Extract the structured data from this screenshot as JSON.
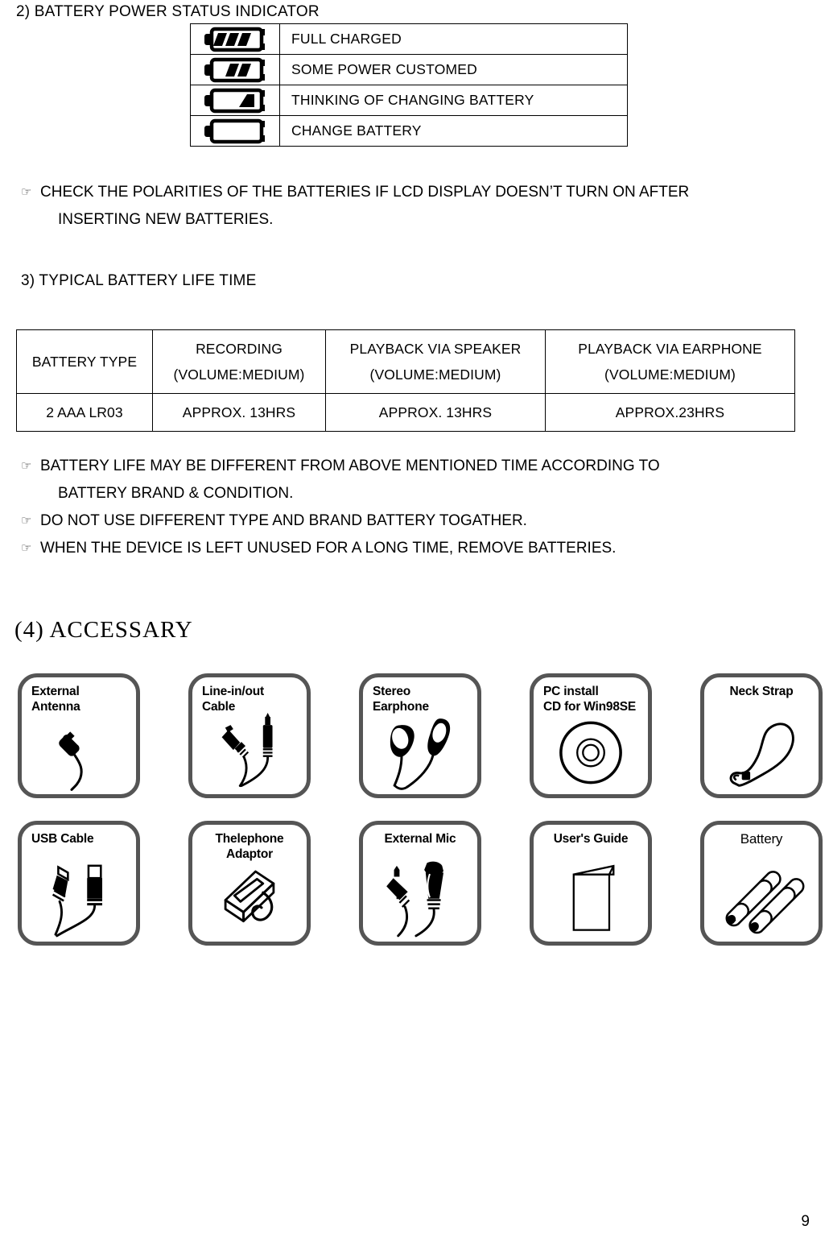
{
  "section_battery_indicator": {
    "heading": "2) BATTERY POWER STATUS INDICATOR",
    "rows": [
      {
        "icon": "battery-full-icon",
        "segments": 3,
        "label": "FULL CHARGED"
      },
      {
        "icon": "battery-two-bar-icon",
        "segments": 2,
        "label": "SOME POWER CUSTOMED"
      },
      {
        "icon": "battery-one-bar-icon",
        "segments": 1,
        "label": "THINKING OF CHANGING BATTERY"
      },
      {
        "icon": "battery-empty-icon",
        "segments": 0,
        "label": "CHANGE BATTERY"
      }
    ]
  },
  "note_polarities": {
    "bullet": "☞",
    "line1": "CHECK THE POLARITIES OF THE BATTERIES IF LCD DISPLAY DOESN’T TURN ON AFTER",
    "line2": "INSERTING NEW BATTERIES."
  },
  "section_life_time": {
    "heading": "3) TYPICAL BATTERY LIFE TIME",
    "headers": [
      {
        "line1": "BATTERY TYPE",
        "line2": ""
      },
      {
        "line1": "RECORDING",
        "line2": "(VOLUME:MEDIUM)"
      },
      {
        "line1": "PLAYBACK VIA SPEAKER",
        "line2": "(VOLUME:MEDIUM)"
      },
      {
        "line1": "PLAYBACK VIA EARPHONE",
        "line2": "(VOLUME:MEDIUM)"
      }
    ],
    "data_row": [
      "2 AAA LR03",
      "APPROX. 13HRS",
      "APPROX. 13HRS",
      "APPROX.23HRS"
    ]
  },
  "notes_battery": {
    "bullet": "☞",
    "items": [
      {
        "line1": "BATTERY LIFE MAY BE DIFFERENT FROM ABOVE MENTIONED TIME ACCORDING TO",
        "line2": "BATTERY BRAND & CONDITION."
      },
      {
        "line1": "DO NOT USE DIFFERENT TYPE AND BRAND BATTERY TOGATHER.",
        "line2": ""
      },
      {
        "line1": "WHEN THE DEVICE IS LEFT UNUSED FOR A LONG TIME, REMOVE BATTERIES.",
        "line2": ""
      }
    ]
  },
  "section_accessary": {
    "heading": "(4) ACCESSARY",
    "row1": [
      {
        "name": "external-antenna",
        "line1": "External",
        "line2": "Antenna",
        "icon": "antenna-plug-icon"
      },
      {
        "name": "line-in-out-cable",
        "line1": "Line-in/out",
        "line2": "Cable",
        "icon": "audio-cable-icon"
      },
      {
        "name": "stereo-earphone",
        "line1": "Stereo",
        "line2": "Earphone",
        "icon": "earphone-icon"
      },
      {
        "name": "pc-install-cd",
        "line1": "PC install",
        "line2": "CD for Win98SE",
        "icon": "cd-disc-icon"
      },
      {
        "name": "neck-strap",
        "line1": "Neck Strap",
        "line2": "",
        "icon": "neck-strap-icon"
      }
    ],
    "row2": [
      {
        "name": "usb-cable",
        "line1": "USB Cable",
        "line2": "",
        "icon": "usb-cable-icon"
      },
      {
        "name": "telephone-adaptor",
        "line1": "Thelephone",
        "line2": "Adaptor",
        "icon": "telephone-adaptor-icon"
      },
      {
        "name": "external-mic",
        "line1": "External Mic",
        "line2": "",
        "icon": "external-mic-icon"
      },
      {
        "name": "users-guide",
        "line1": "User's Guide",
        "line2": "",
        "icon": "booklet-icon"
      },
      {
        "name": "battery-pack",
        "line1": "Battery",
        "line2": "",
        "icon": "aaa-batteries-icon"
      }
    ]
  },
  "footer": {
    "page_number": "9"
  },
  "colors": {
    "box_border": "#555555",
    "text": "#000000",
    "rule": "#000000"
  }
}
